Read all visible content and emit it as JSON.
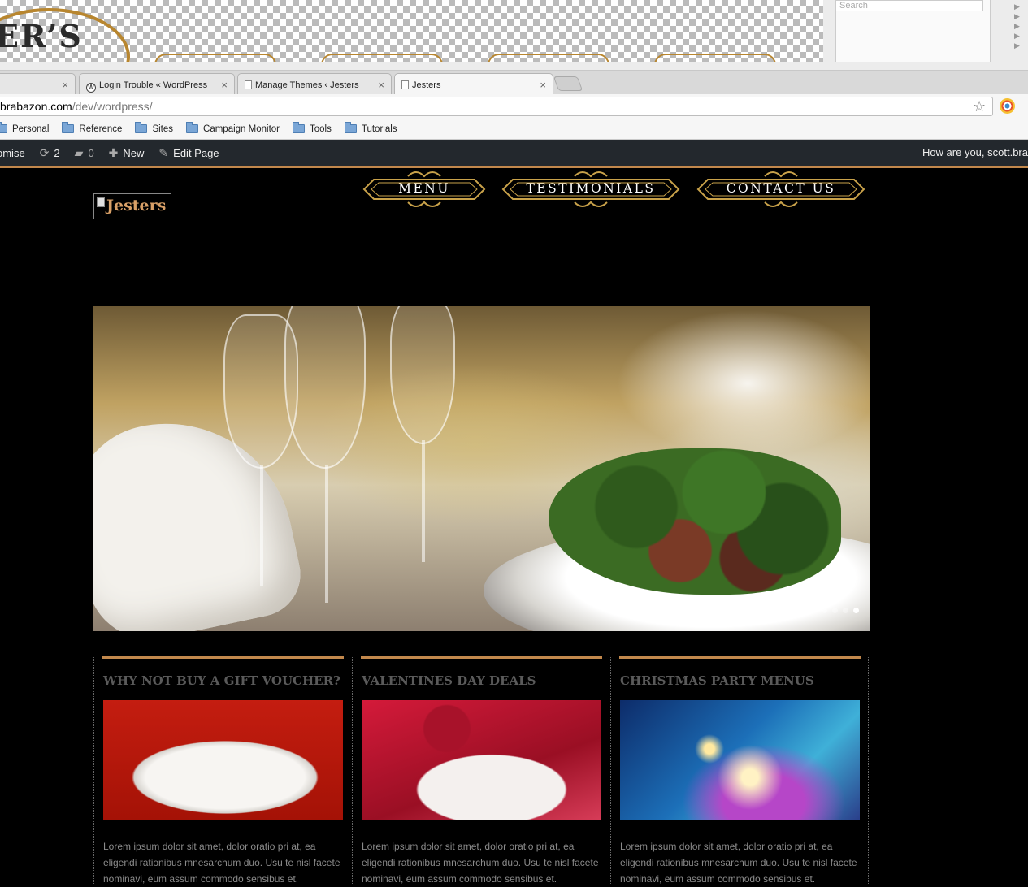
{
  "background_window": {
    "logo_fragment": "ER’S",
    "search_placeholder": "Search"
  },
  "tabs": [
    {
      "label": "",
      "close": "×"
    },
    {
      "label": "Login Trouble « WordPress",
      "close": "×"
    },
    {
      "label": "Manage Themes ‹ Jesters",
      "close": "×"
    },
    {
      "label": "Jesters",
      "close": "×"
    }
  ],
  "address": {
    "host": "brabazon.com",
    "path": "/dev/wordpress/"
  },
  "bookmarks": [
    "Personal",
    "Reference",
    "Sites",
    "Campaign Monitor",
    "Tools",
    "Tutorials"
  ],
  "admin_bar": {
    "site_fragment": "omise",
    "updates_count": "2",
    "comments_count": "0",
    "new_label": "New",
    "edit_label": "Edit Page",
    "greeting": "How are you, scott.bra"
  },
  "site": {
    "logo_alt": "Jesters",
    "nav": [
      "MENU",
      "TESTIMONIALS",
      "CONTACT US"
    ],
    "slider_dots": 4,
    "slider_active": 4,
    "columns": [
      {
        "title": "WHY NOT BUY A GIFT VOUCHER?",
        "body": "Lorem ipsum dolor sit amet, dolor oratio pri at, ea eligendi rationibus mnesarchum duo. Usu te nisl facete nominavi, eum assum commodo sensibus et."
      },
      {
        "title": "VALENTINES DAY DEALS",
        "body": "Lorem ipsum dolor sit amet, dolor oratio pri at, ea eligendi rationibus mnesarchum duo. Usu te nisl facete nominavi, eum assum commodo sensibus et."
      },
      {
        "title": "CHRISTMAS PARTY MENUS",
        "body": "Lorem ipsum dolor sit amet, dolor oratio pri at, ea eligendi rationibus mnesarchum duo. Usu te nisl facete nominavi, eum assum commodo sensibus et."
      }
    ]
  },
  "colors": {
    "accent": "#c2884c",
    "gold": "#b8862f",
    "admin_bg": "#23282d"
  }
}
